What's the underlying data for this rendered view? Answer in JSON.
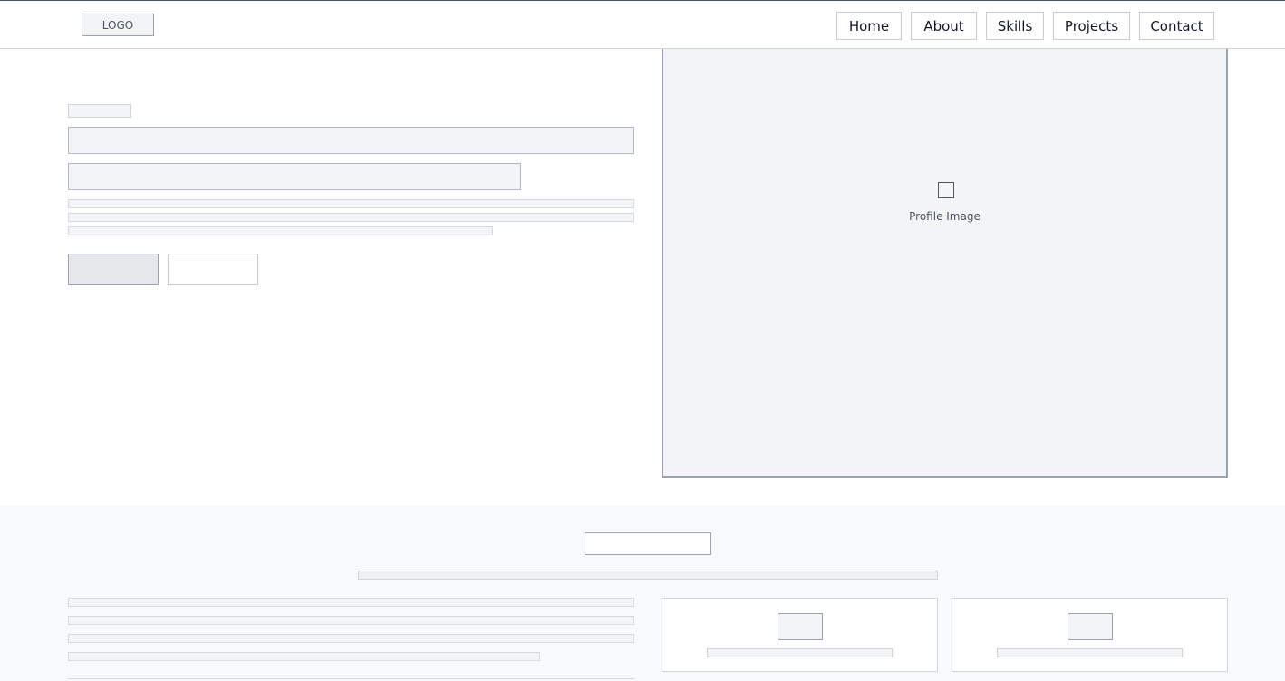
{
  "header": {
    "logo": "LOGO",
    "nav": [
      "Home",
      "About",
      "Skills",
      "Projects",
      "Contact"
    ]
  },
  "hero": {
    "profile_image_label": "Profile Image",
    "profile_image_icon": "image-placeholder-icon"
  },
  "colors": {
    "placeholder_fill": "#f3f4f6",
    "placeholder_border": "#9ca3af",
    "section_background": "#f8f9fa"
  }
}
